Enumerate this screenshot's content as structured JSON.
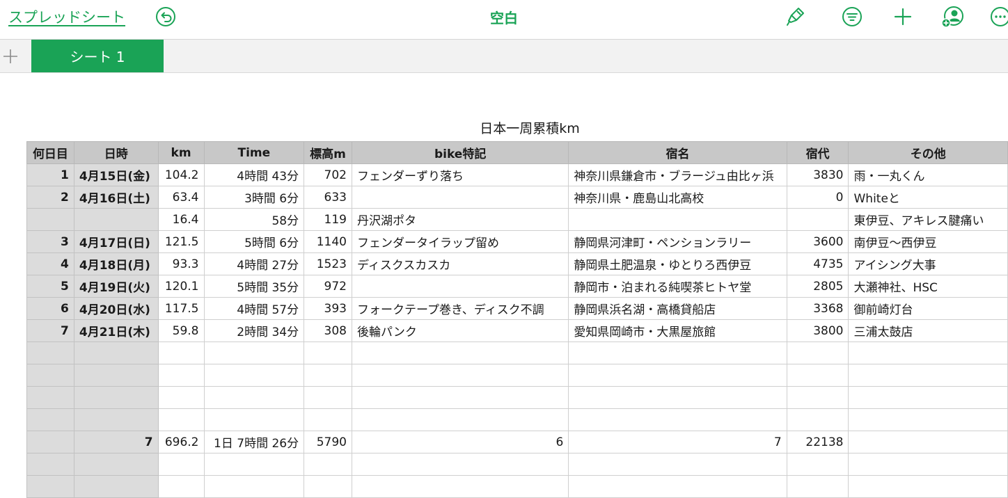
{
  "toolbar": {
    "back_label": "スプレッドシート",
    "title": "空白",
    "accent": "#1aa356",
    "icons": [
      "undo-icon",
      "format-brush-icon",
      "filter-icon",
      "add-icon",
      "collaborate-icon",
      "more-icon"
    ]
  },
  "tabs": {
    "add_icon": "plus-icon",
    "sheets": [
      {
        "label": "シート 1",
        "active": true
      }
    ]
  },
  "sheet": {
    "title": "日本一周累積km",
    "headers": [
      "何日目",
      "日時",
      "km",
      "Time",
      "標高m",
      "bike特記",
      "宿名",
      "宿代",
      "その他"
    ],
    "rows": [
      [
        "1",
        "4月15日(金)",
        "104.2",
        "4時間 43分",
        "702",
        "フェンダーずり落ち",
        "神奈川県鎌倉市・ブラージュ由比ヶ浜",
        "3830",
        "雨・一丸くん"
      ],
      [
        "2",
        "4月16日(土)",
        "63.4",
        "3時間 6分",
        "633",
        "",
        "神奈川県・鹿島山北高校",
        "0",
        "Whiteと"
      ],
      [
        "",
        "",
        "16.4",
        "58分",
        "119",
        "丹沢湖ポタ",
        "",
        "",
        "東伊豆、アキレス腱痛い"
      ],
      [
        "3",
        "4月17日(日)",
        "121.5",
        "5時間 6分",
        "1140",
        "フェンダータイラップ留め",
        "静岡県河津町・ペンションラリー",
        "3600",
        "南伊豆〜西伊豆"
      ],
      [
        "4",
        "4月18日(月)",
        "93.3",
        "4時間 27分",
        "1523",
        "ディスクスカスカ",
        "静岡県土肥温泉・ゆとりろ西伊豆",
        "4735",
        "アイシング大事"
      ],
      [
        "5",
        "4月19日(火)",
        "120.1",
        "5時間 35分",
        "972",
        "",
        "静岡市・泊まれる純喫茶ヒトヤ堂",
        "2805",
        "大瀬神社、HSC"
      ],
      [
        "6",
        "4月20日(水)",
        "117.5",
        "4時間 57分",
        "393",
        "フォークテープ巻き、ディスク不調",
        "静岡県浜名湖・高橋貸船店",
        "3368",
        "御前崎灯台"
      ],
      [
        "7",
        "4月21日(木)",
        "59.8",
        "2時間 34分",
        "308",
        "後輪パンク",
        "愛知県岡崎市・大黒屋旅館",
        "3800",
        "三浦太鼓店"
      ],
      [
        "",
        "",
        "",
        "",
        "",
        "",
        "",
        "",
        ""
      ],
      [
        "",
        "",
        "",
        "",
        "",
        "",
        "",
        "",
        ""
      ],
      [
        "",
        "",
        "",
        "",
        "",
        "",
        "",
        "",
        ""
      ],
      [
        "",
        "",
        "",
        "",
        "",
        "",
        "",
        "",
        ""
      ],
      [
        "",
        "7",
        "696.2",
        "1日 7時間 26分",
        "5790",
        "6",
        "7",
        "22138",
        ""
      ],
      [
        "",
        "",
        "",
        "",
        "",
        "",
        "",
        "",
        ""
      ],
      [
        "",
        "",
        "",
        "",
        "",
        "",
        "",
        "",
        ""
      ]
    ]
  }
}
